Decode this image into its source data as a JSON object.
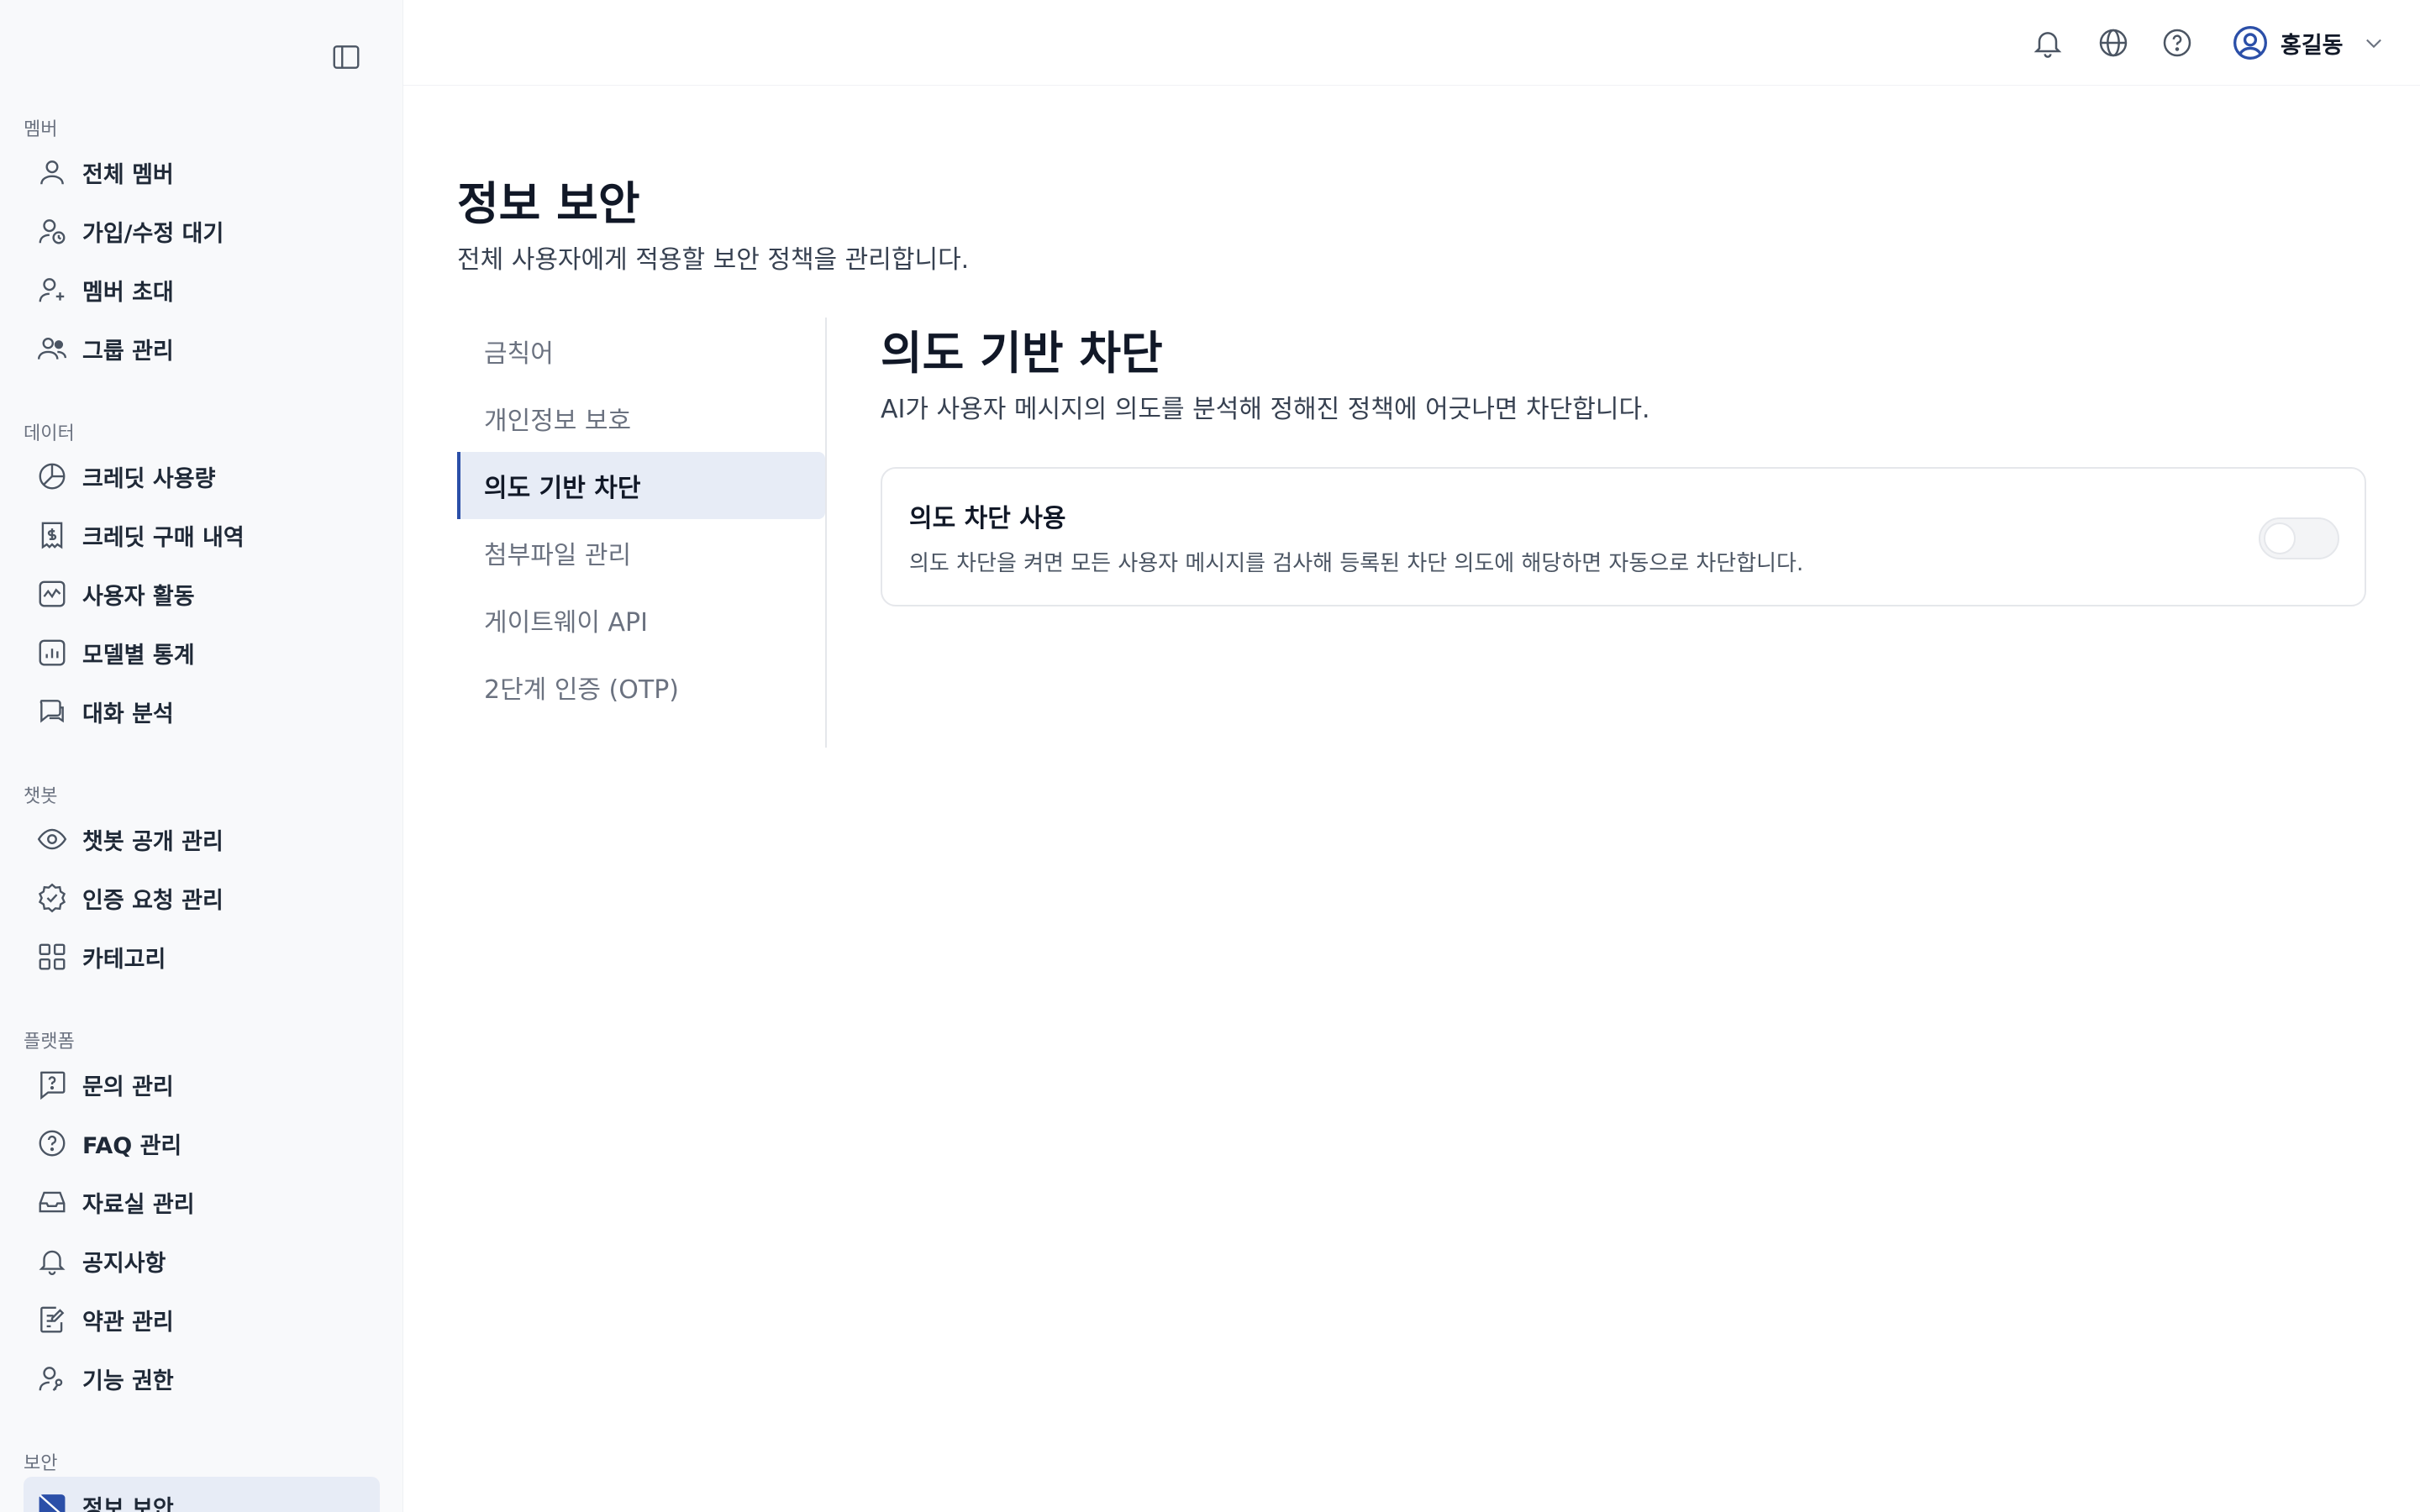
{
  "sidebar": {
    "sections": [
      {
        "label": "멤버",
        "items": [
          {
            "label": "전체 멤버",
            "icon": "user-icon"
          },
          {
            "label": "가입/수정 대기",
            "icon": "user-clock-icon"
          },
          {
            "label": "멤버 초대",
            "icon": "user-plus-icon"
          },
          {
            "label": "그룹 관리",
            "icon": "users-icon"
          }
        ]
      },
      {
        "label": "데이터",
        "items": [
          {
            "label": "크레딧 사용량",
            "icon": "pie-chart-icon"
          },
          {
            "label": "크레딧 구매 내역",
            "icon": "receipt-icon"
          },
          {
            "label": "사용자 활동",
            "icon": "activity-icon"
          },
          {
            "label": "모델별 통계",
            "icon": "bar-chart-icon"
          },
          {
            "label": "대화 분석",
            "icon": "chat-icon"
          }
        ]
      },
      {
        "label": "챗봇",
        "items": [
          {
            "label": "챗봇 공개 관리",
            "icon": "eye-icon"
          },
          {
            "label": "인증 요청 관리",
            "icon": "badge-check-icon"
          },
          {
            "label": "카테고리",
            "icon": "grid-icon"
          }
        ]
      },
      {
        "label": "플랫폼",
        "items": [
          {
            "label": "문의 관리",
            "icon": "message-question-icon"
          },
          {
            "label": "FAQ 관리",
            "icon": "help-circle-icon"
          },
          {
            "label": "자료실 관리",
            "icon": "inbox-icon"
          },
          {
            "label": "공지사항",
            "icon": "bell-icon"
          },
          {
            "label": "약관 관리",
            "icon": "edit-doc-icon"
          },
          {
            "label": "기능 권한",
            "icon": "user-key-icon"
          }
        ]
      },
      {
        "label": "보안",
        "items": [
          {
            "label": "정보 보안",
            "icon": "shield-icon",
            "active": true
          }
        ]
      }
    ]
  },
  "topbar": {
    "user_name": "홍길동",
    "icons": [
      "bell-icon",
      "globe-icon",
      "help-icon"
    ]
  },
  "page": {
    "title": "정보 보안",
    "subtitle": "전체 사용자에게 적용할 보안 정책을 관리합니다."
  },
  "subnav": {
    "items": [
      {
        "label": "금칙어"
      },
      {
        "label": "개인정보 보호"
      },
      {
        "label": "의도 기반 차단",
        "active": true
      },
      {
        "label": "첨부파일 관리"
      },
      {
        "label": "게이트웨이 API"
      },
      {
        "label": "2단계 인증 (OTP)"
      }
    ]
  },
  "content": {
    "title": "의도 기반 차단",
    "description": "AI가 사용자 메시지의 의도를 분석해 정해진 정책에 어긋나면 차단합니다.",
    "card": {
      "title": "의도 차단 사용",
      "description": "의도 차단을 켜면 모든 사용자 메시지를 검사해 등록된 차단 의도에 해당하면 자동으로 차단합니다.",
      "toggle_on": false
    }
  },
  "colors": {
    "accent": "#2b4fa8",
    "active_bg": "#e7ecf6",
    "sidebar_bg": "#f8f9fb"
  }
}
